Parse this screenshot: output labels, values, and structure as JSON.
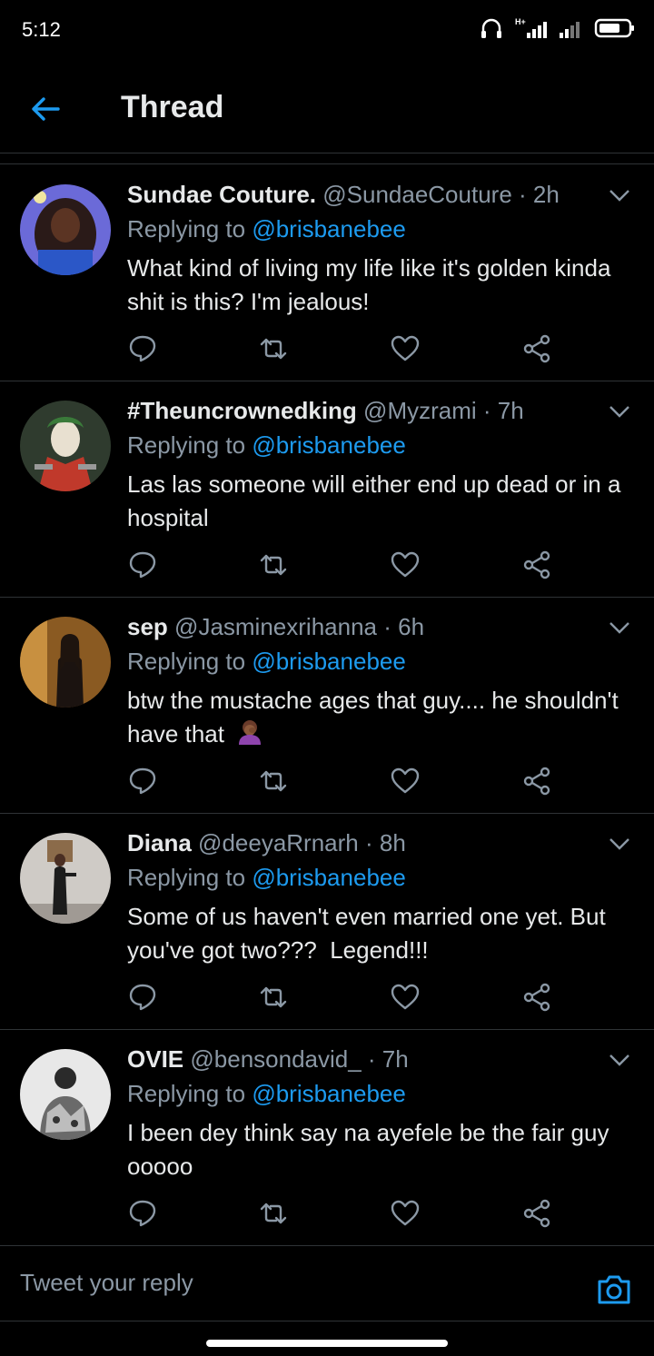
{
  "status_bar": {
    "time": "5:12",
    "network": "H+"
  },
  "header": {
    "title": "Thread",
    "back_icon": "arrow-left-icon"
  },
  "colors": {
    "accent": "#1d9bf0",
    "muted": "#8b98a5",
    "background": "#000000",
    "divider": "#2f3336"
  },
  "tweets": [
    {
      "name": "Sundae Couture.",
      "handle": "@SundaeCouture",
      "dot": " · ",
      "time": "2h",
      "replying_label": "Replying to ",
      "replying_to": "@brisbanebee",
      "text": "What kind of living my life like it's golden kinda shit is this? I'm jealous!",
      "emoji": ""
    },
    {
      "name": "#Theuncrownedking",
      "handle": "@Myzrami",
      "dot": " · ",
      "time": "7h",
      "replying_label": "Replying to ",
      "replying_to": "@brisbanebee",
      "text": "Las las someone will either end up dead or in a hospital",
      "emoji": ""
    },
    {
      "name": "sep",
      "handle": "@Jasminexrihanna",
      "dot": " · ",
      "time": "6h",
      "replying_label": "Replying to ",
      "replying_to": "@brisbanebee",
      "text": "btw the mustache ages that guy.... he shouldn't have that",
      "emoji": "facepalm-emoji"
    },
    {
      "name": "Diana",
      "handle": "@deeyaRrnarh",
      "dot": " · ",
      "time": "8h",
      "replying_label": "Replying to ",
      "replying_to": "@brisbanebee",
      "text": "Some of us haven't even married one yet. But you've got two???  Legend!!!",
      "emoji": ""
    },
    {
      "name": "OVIE",
      "handle": "@bensondavid_",
      "dot": " · ",
      "time": "7h",
      "replying_label": "Replying to ",
      "replying_to": "@brisbanebee",
      "text": "I been dey think say na ayefele be the fair guy ooooo",
      "emoji": ""
    }
  ],
  "reply_bar": {
    "placeholder": "Tweet your reply",
    "camera_icon": "camera-icon"
  }
}
